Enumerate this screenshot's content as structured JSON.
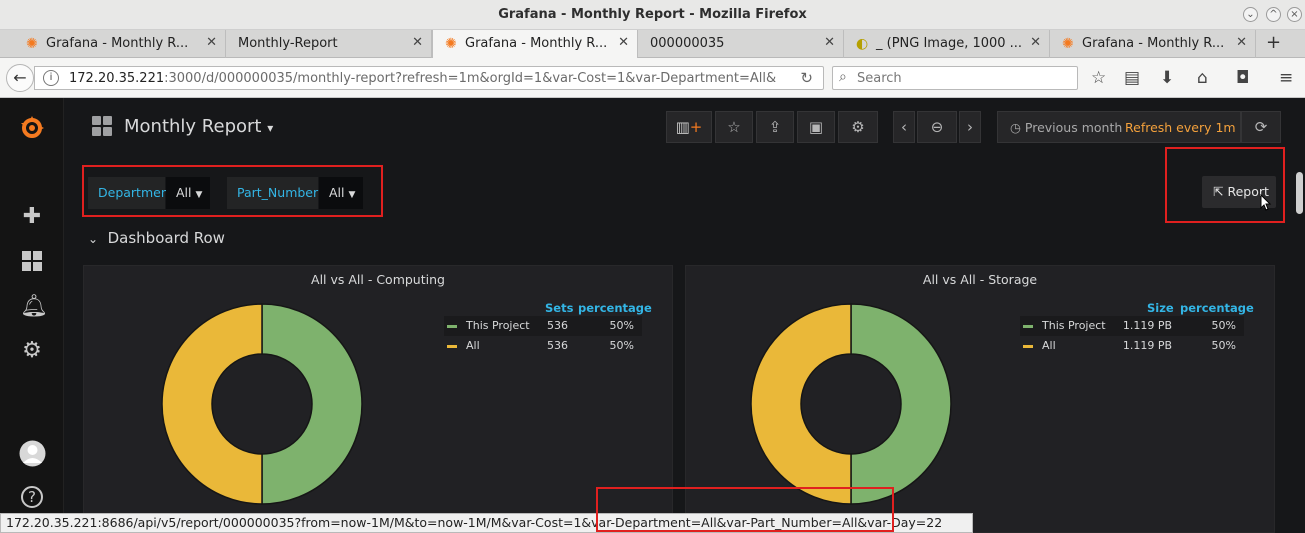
{
  "window": {
    "title": "Grafana - Monthly Report - Mozilla Firefox"
  },
  "tabs": [
    {
      "label": "Grafana - Monthly R...",
      "icon": "grafana-icon"
    },
    {
      "label": "Monthly-Report",
      "icon": ""
    },
    {
      "label": "Grafana - Monthly R...",
      "icon": "grafana-icon",
      "active": true
    },
    {
      "label": "000000035",
      "icon": ""
    },
    {
      "label": "_ (PNG Image, 1000 ...",
      "icon": "png-icon"
    },
    {
      "label": "Grafana - Monthly R...",
      "icon": "grafana-icon"
    }
  ],
  "navbar": {
    "url_host": "172.20.35.221",
    "url_rest": ":3000/d/000000035/monthly-report?refresh=1m&orgId=1&var-Cost=1&var-Department=All&",
    "search_placeholder": "Search"
  },
  "dashboard": {
    "title": "Monthly Report",
    "time_range": "Previous month",
    "refresh": "Refresh every 1m",
    "variables": [
      {
        "label": "Department",
        "value": "All"
      },
      {
        "label": "Part_Number",
        "value": "All"
      }
    ],
    "report_button": "Report",
    "row_title": "Dashboard Row",
    "colors": {
      "green": "#7eb26d",
      "yellow": "#eab839",
      "accent": "#33b5e5",
      "refresh": "#f4a13c"
    }
  },
  "panels": [
    {
      "title": "All vs All - Computing",
      "value_header": "Sets",
      "pct_header": "percentage",
      "legend": [
        {
          "name": "This Project",
          "value": "536",
          "pct": "50%"
        },
        {
          "name": "All",
          "value": "536",
          "pct": "50%"
        }
      ]
    },
    {
      "title": "All vs All - Storage",
      "value_header": "Size",
      "pct_header": "percentage",
      "legend": [
        {
          "name": "This Project",
          "value": "1.119 PB",
          "pct": "50%"
        },
        {
          "name": "All",
          "value": "1.119 PB",
          "pct": "50%"
        }
      ]
    }
  ],
  "statusbar": {
    "text": "172.20.35.221:8686/api/v5/report/000000035?from=now-1M/M&to=now-1M/M&var-Cost=1&var-Department=All&var-Part_Number=All&var-Day=22"
  }
}
